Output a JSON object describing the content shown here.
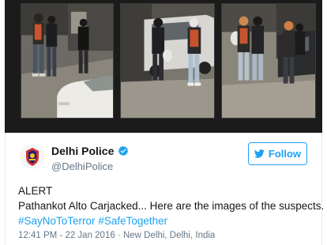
{
  "photos": [
    {
      "alt": "suspects-photo-1"
    },
    {
      "alt": "suspects-photo-2"
    },
    {
      "alt": "suspects-photo-3"
    }
  ],
  "tweet": {
    "display_name": "Delhi Police",
    "handle": "@DelhiPolice",
    "verified_icon": "verified-badge-icon",
    "follow_label": "Follow",
    "follow_icon": "twitter-bird-icon",
    "text_line1": "ALERT",
    "text_line2": "Pathankot Alto Carjacked... Here are the images of the suspects.",
    "hashtags": [
      "#SayNoToTerror",
      "#SafeTogether"
    ],
    "timestamp": "12:41 PM - 22 Jan 2016",
    "separator": " · ",
    "location": "New Delhi, Delhi, India"
  },
  "colors": {
    "accent": "#1da1f2",
    "text": "#14171a",
    "muted": "#657786"
  }
}
